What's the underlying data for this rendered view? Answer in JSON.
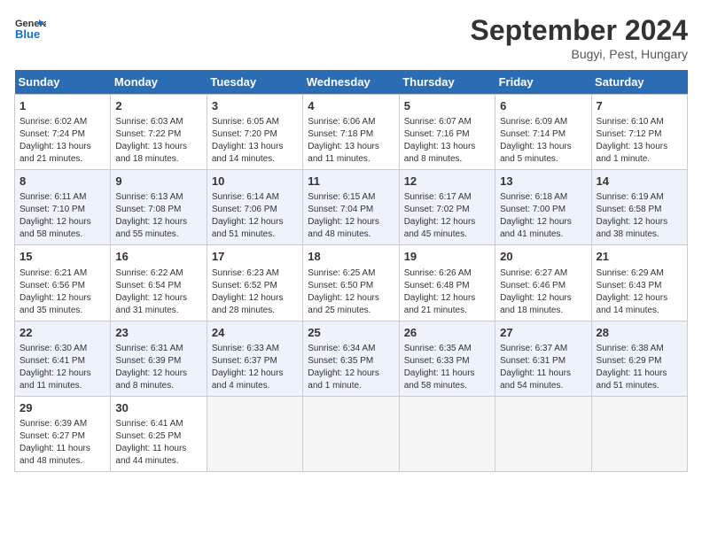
{
  "header": {
    "logo_line1": "General",
    "logo_line2": "Blue",
    "month": "September 2024",
    "location": "Bugyi, Pest, Hungary"
  },
  "weekdays": [
    "Sunday",
    "Monday",
    "Tuesday",
    "Wednesday",
    "Thursday",
    "Friday",
    "Saturday"
  ],
  "weeks": [
    [
      {
        "day": "1",
        "info": "Sunrise: 6:02 AM\nSunset: 7:24 PM\nDaylight: 13 hours\nand 21 minutes."
      },
      {
        "day": "2",
        "info": "Sunrise: 6:03 AM\nSunset: 7:22 PM\nDaylight: 13 hours\nand 18 minutes."
      },
      {
        "day": "3",
        "info": "Sunrise: 6:05 AM\nSunset: 7:20 PM\nDaylight: 13 hours\nand 14 minutes."
      },
      {
        "day": "4",
        "info": "Sunrise: 6:06 AM\nSunset: 7:18 PM\nDaylight: 13 hours\nand 11 minutes."
      },
      {
        "day": "5",
        "info": "Sunrise: 6:07 AM\nSunset: 7:16 PM\nDaylight: 13 hours\nand 8 minutes."
      },
      {
        "day": "6",
        "info": "Sunrise: 6:09 AM\nSunset: 7:14 PM\nDaylight: 13 hours\nand 5 minutes."
      },
      {
        "day": "7",
        "info": "Sunrise: 6:10 AM\nSunset: 7:12 PM\nDaylight: 13 hours\nand 1 minute."
      }
    ],
    [
      {
        "day": "8",
        "info": "Sunrise: 6:11 AM\nSunset: 7:10 PM\nDaylight: 12 hours\nand 58 minutes."
      },
      {
        "day": "9",
        "info": "Sunrise: 6:13 AM\nSunset: 7:08 PM\nDaylight: 12 hours\nand 55 minutes."
      },
      {
        "day": "10",
        "info": "Sunrise: 6:14 AM\nSunset: 7:06 PM\nDaylight: 12 hours\nand 51 minutes."
      },
      {
        "day": "11",
        "info": "Sunrise: 6:15 AM\nSunset: 7:04 PM\nDaylight: 12 hours\nand 48 minutes."
      },
      {
        "day": "12",
        "info": "Sunrise: 6:17 AM\nSunset: 7:02 PM\nDaylight: 12 hours\nand 45 minutes."
      },
      {
        "day": "13",
        "info": "Sunrise: 6:18 AM\nSunset: 7:00 PM\nDaylight: 12 hours\nand 41 minutes."
      },
      {
        "day": "14",
        "info": "Sunrise: 6:19 AM\nSunset: 6:58 PM\nDaylight: 12 hours\nand 38 minutes."
      }
    ],
    [
      {
        "day": "15",
        "info": "Sunrise: 6:21 AM\nSunset: 6:56 PM\nDaylight: 12 hours\nand 35 minutes."
      },
      {
        "day": "16",
        "info": "Sunrise: 6:22 AM\nSunset: 6:54 PM\nDaylight: 12 hours\nand 31 minutes."
      },
      {
        "day": "17",
        "info": "Sunrise: 6:23 AM\nSunset: 6:52 PM\nDaylight: 12 hours\nand 28 minutes."
      },
      {
        "day": "18",
        "info": "Sunrise: 6:25 AM\nSunset: 6:50 PM\nDaylight: 12 hours\nand 25 minutes."
      },
      {
        "day": "19",
        "info": "Sunrise: 6:26 AM\nSunset: 6:48 PM\nDaylight: 12 hours\nand 21 minutes."
      },
      {
        "day": "20",
        "info": "Sunrise: 6:27 AM\nSunset: 6:46 PM\nDaylight: 12 hours\nand 18 minutes."
      },
      {
        "day": "21",
        "info": "Sunrise: 6:29 AM\nSunset: 6:43 PM\nDaylight: 12 hours\nand 14 minutes."
      }
    ],
    [
      {
        "day": "22",
        "info": "Sunrise: 6:30 AM\nSunset: 6:41 PM\nDaylight: 12 hours\nand 11 minutes."
      },
      {
        "day": "23",
        "info": "Sunrise: 6:31 AM\nSunset: 6:39 PM\nDaylight: 12 hours\nand 8 minutes."
      },
      {
        "day": "24",
        "info": "Sunrise: 6:33 AM\nSunset: 6:37 PM\nDaylight: 12 hours\nand 4 minutes."
      },
      {
        "day": "25",
        "info": "Sunrise: 6:34 AM\nSunset: 6:35 PM\nDaylight: 12 hours\nand 1 minute."
      },
      {
        "day": "26",
        "info": "Sunrise: 6:35 AM\nSunset: 6:33 PM\nDaylight: 11 hours\nand 58 minutes."
      },
      {
        "day": "27",
        "info": "Sunrise: 6:37 AM\nSunset: 6:31 PM\nDaylight: 11 hours\nand 54 minutes."
      },
      {
        "day": "28",
        "info": "Sunrise: 6:38 AM\nSunset: 6:29 PM\nDaylight: 11 hours\nand 51 minutes."
      }
    ],
    [
      {
        "day": "29",
        "info": "Sunrise: 6:39 AM\nSunset: 6:27 PM\nDaylight: 11 hours\nand 48 minutes."
      },
      {
        "day": "30",
        "info": "Sunrise: 6:41 AM\nSunset: 6:25 PM\nDaylight: 11 hours\nand 44 minutes."
      },
      {
        "day": "",
        "info": ""
      },
      {
        "day": "",
        "info": ""
      },
      {
        "day": "",
        "info": ""
      },
      {
        "day": "",
        "info": ""
      },
      {
        "day": "",
        "info": ""
      }
    ]
  ]
}
